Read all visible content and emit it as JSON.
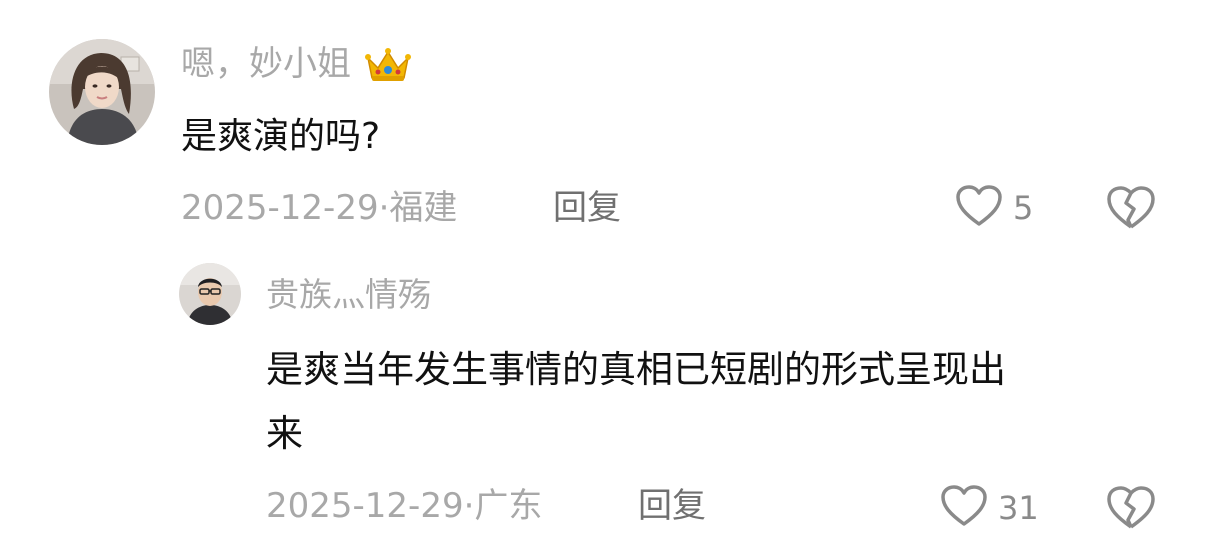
{
  "comments": [
    {
      "username": "嗯，妙小姐",
      "badge_icon": "crown-icon",
      "content": "是爽演的吗?",
      "date": "2025-12-29",
      "location": "福建",
      "reply_label": "回复",
      "likes": "5"
    },
    {
      "username": "贵族灬情殇",
      "content_line1": "是爽当年发生事情的真相已短剧的形式呈现出",
      "content_line2": "来",
      "date": "2025-12-29",
      "location": "广东",
      "reply_label": "回复",
      "likes": "31"
    }
  ],
  "colors": {
    "text_primary": "#111111",
    "text_secondary": "#a8a8a8",
    "reply": "#707070",
    "icon": "#8a8a8a",
    "crown_gold": "#f2b705",
    "crown_gem": "#2e8bd8"
  }
}
